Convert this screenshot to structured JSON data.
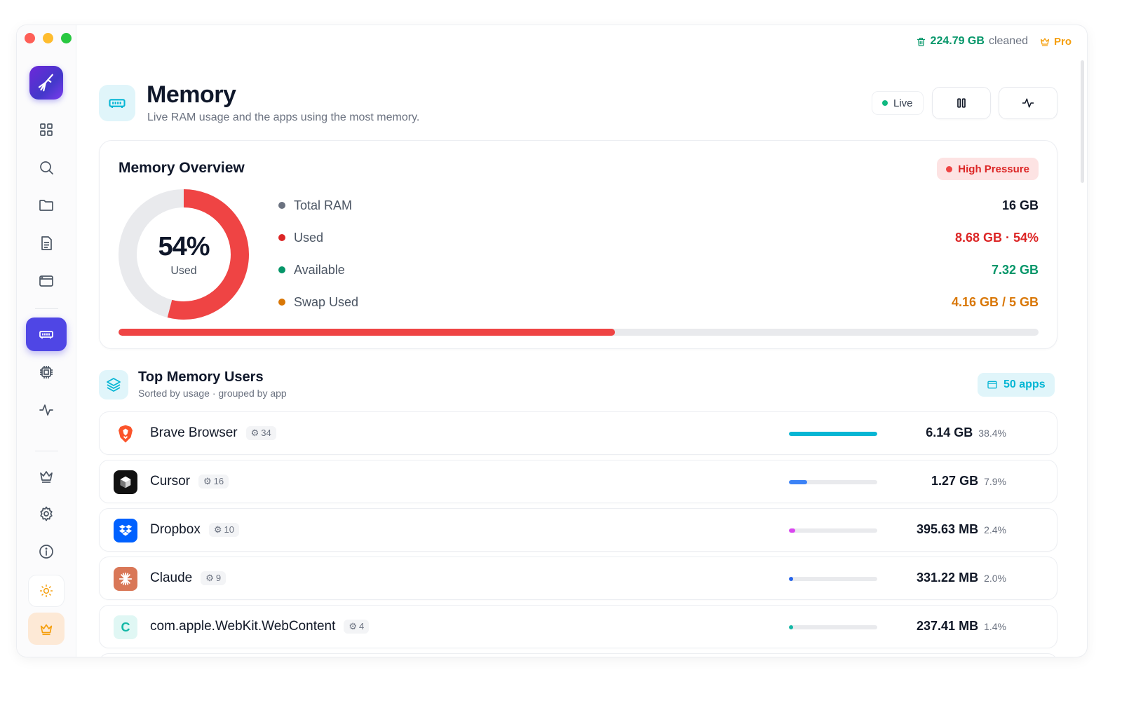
{
  "status": {
    "cleaned_amount": "224.79 GB",
    "cleaned_label": "cleaned",
    "pro_label": "Pro"
  },
  "header": {
    "title": "Memory",
    "subtitle": "Live RAM usage and the apps using the most memory.",
    "live_label": "Live"
  },
  "overview": {
    "title": "Memory Overview",
    "pressure_label": "High Pressure",
    "used_percent": 54,
    "donut_value": "54%",
    "donut_label": "Used",
    "stats": [
      {
        "label": "Total RAM",
        "value": "16 GB",
        "color": "#6b7280",
        "value_color": "#111827"
      },
      {
        "label": "Used",
        "value": "8.68 GB · 54%",
        "color": "#dc2626",
        "value_color": "#dc2626"
      },
      {
        "label": "Available",
        "value": "7.32 GB",
        "color": "#059669",
        "value_color": "#059669"
      },
      {
        "label": "Swap Used",
        "value": "4.16 GB / 5 GB",
        "color": "#d97706",
        "value_color": "#d97706"
      }
    ]
  },
  "top_users": {
    "title": "Top Memory Users",
    "subtitle": "Sorted by usage · grouped by app",
    "apps_count_label": "50 apps",
    "apps": [
      {
        "name": "Brave Browser",
        "count": "34",
        "size": "6.14 GB",
        "percent": "38.4%",
        "fill": 1.0,
        "color": "#06b6d4",
        "icon": "brave-icon"
      },
      {
        "name": "Cursor",
        "count": "16",
        "size": "1.27 GB",
        "percent": "7.9%",
        "fill": 0.21,
        "color": "#3b82f6",
        "icon": "cursor-icon"
      },
      {
        "name": "Dropbox",
        "count": "10",
        "size": "395.63 MB",
        "percent": "2.4%",
        "fill": 0.07,
        "color": "#d946ef",
        "icon": "dropbox-icon"
      },
      {
        "name": "Claude",
        "count": "9",
        "size": "331.22 MB",
        "percent": "2.0%",
        "fill": 0.05,
        "color": "#2563eb",
        "icon": "claude-icon"
      },
      {
        "name": "com.apple.WebKit.WebContent",
        "count": "4",
        "size": "237.41 MB",
        "percent": "1.4%",
        "fill": 0.035,
        "color": "#14b8a6",
        "icon": "webkit-letter-icon",
        "letter": "C"
      }
    ]
  },
  "colors": {
    "accent": "#4f46e5",
    "cyan": "#06b6d4",
    "danger": "#ef4444"
  }
}
